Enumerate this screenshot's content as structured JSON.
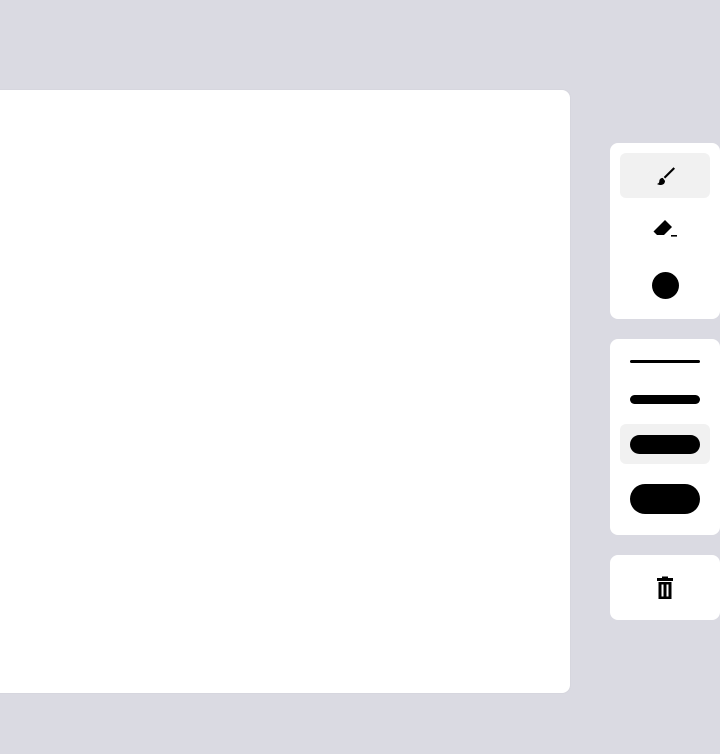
{
  "toolbar": {
    "tools": [
      {
        "name": "brush",
        "icon": "brush-icon",
        "selected": true
      },
      {
        "name": "eraser",
        "icon": "eraser-icon",
        "selected": false
      },
      {
        "name": "color",
        "icon": "color-swatch",
        "color": "#000000",
        "selected": false
      }
    ],
    "sizes": [
      {
        "level": 1,
        "selected": false
      },
      {
        "level": 2,
        "selected": false
      },
      {
        "level": 3,
        "selected": true
      },
      {
        "level": 4,
        "selected": false
      }
    ],
    "actions": [
      {
        "name": "clear",
        "icon": "trash-icon"
      }
    ]
  },
  "colors": {
    "background": "#dadae2",
    "canvas": "#ffffff",
    "selected_button": "#f1f1f1",
    "ink": "#000000"
  }
}
